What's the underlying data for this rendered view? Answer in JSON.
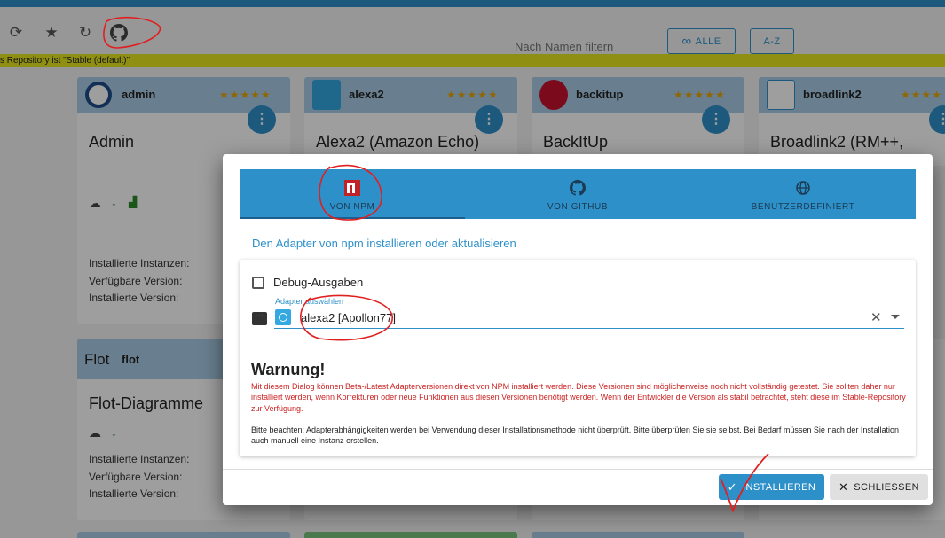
{
  "toolbar": {
    "icons": [
      "refresh-icon",
      "star-icon",
      "update-icon",
      "github-icon"
    ],
    "filter_placeholder": "Nach Namen filtern",
    "all_button": "ALLE",
    "az_button": "A-Z"
  },
  "notice": "s Repository ist \"Stable (default)\"",
  "cards": [
    {
      "name": "admin",
      "title": "Admin",
      "stars": "★★★★★",
      "info": [
        "Installierte Instanzen:",
        "Verfügbare Version:",
        "Installierte Version:"
      ]
    },
    {
      "name": "alexa2",
      "title": "Alexa2 (Amazon Echo)",
      "stars": "★★★★★"
    },
    {
      "name": "backitup",
      "title": "BackItUp",
      "stars": "★★★★★"
    },
    {
      "name": "broadlink2",
      "title": "Broadlink2 (RM++,",
      "stars": "★★★★"
    },
    {
      "name": "flot",
      "title": "Flot-Diagramme",
      "logo_text": "Flot",
      "info": [
        "Installierte Instanzen:",
        "Verfügbare Version:",
        "Installierte Version:"
      ]
    }
  ],
  "dialog": {
    "tabs": [
      {
        "label": "VON NPM",
        "icon": "npm-icon",
        "active": true
      },
      {
        "label": "VON GITHUB",
        "icon": "github-icon",
        "active": false
      },
      {
        "label": "BENUTZERDEFINIERT",
        "icon": "globe-icon",
        "active": false
      }
    ],
    "subtitle": "Den Adapter von npm installieren oder aktualisieren",
    "debug_label": "Debug-Ausgaben",
    "select_label": "Adapter auswählen",
    "select_value": "alexa2 [Apollon77]",
    "warning_title": "Warnung!",
    "warning_text": "Mit diesem Dialog können Beta-/Latest Adapterversionen direkt von NPM installiert werden. Diese Versionen sind möglicherweise noch nicht vollständig getestet. Sie sollten daher nur installiert werden, wenn Korrekturen oder neue Funktionen aus diesen Versionen benötigt werden. Wenn der Entwickler die Version als stabil betrachtet, steht diese im Stable-Repository zur Verfügung.",
    "note_text": "Bitte beachten: Adapterabhängigkeiten werden bei Verwendung dieser Installationsmethode nicht überprüft. Bitte überprüfen Sie sie selbst. Bei Bedarf müssen Sie nach der Installation auch manuell eine Instanz erstellen.",
    "install_button": "INSTALLIEREN",
    "close_button": "SCHLIESSEN"
  },
  "colors": {
    "accent": "#2d90c9",
    "warning": "#cc2222",
    "notice_bg": "#e6e61e",
    "annotation": "#e02020"
  }
}
